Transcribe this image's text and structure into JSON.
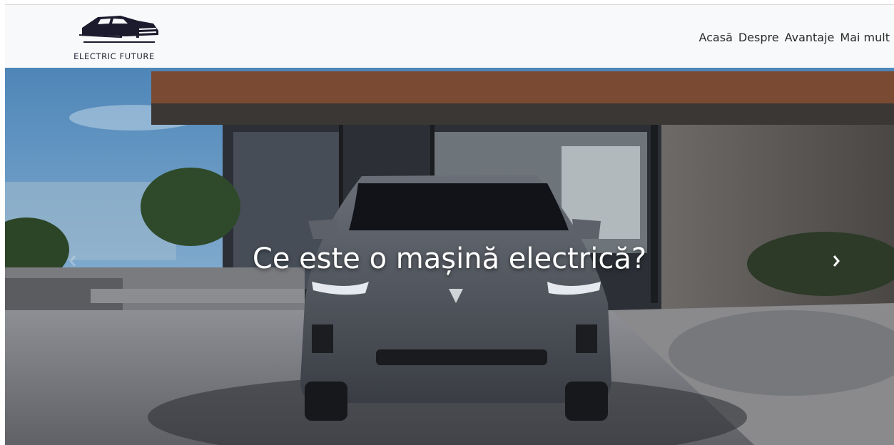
{
  "brand": {
    "name": "ELECTRIC FUTURE",
    "logo_icon": "car-logo-icon"
  },
  "nav": {
    "items": [
      {
        "label": "Acasă"
      },
      {
        "label": "Despre"
      },
      {
        "label": "Avantaje"
      },
      {
        "label": "Mai mult"
      }
    ]
  },
  "hero": {
    "caption": "Ce este o mașină electrică?",
    "prev_icon": "chevron-left-icon",
    "next_icon": "chevron-right-icon"
  },
  "colors": {
    "header_bg": "#f8f9fa",
    "text": "#2b2b2b",
    "caption": "#ffffff"
  }
}
